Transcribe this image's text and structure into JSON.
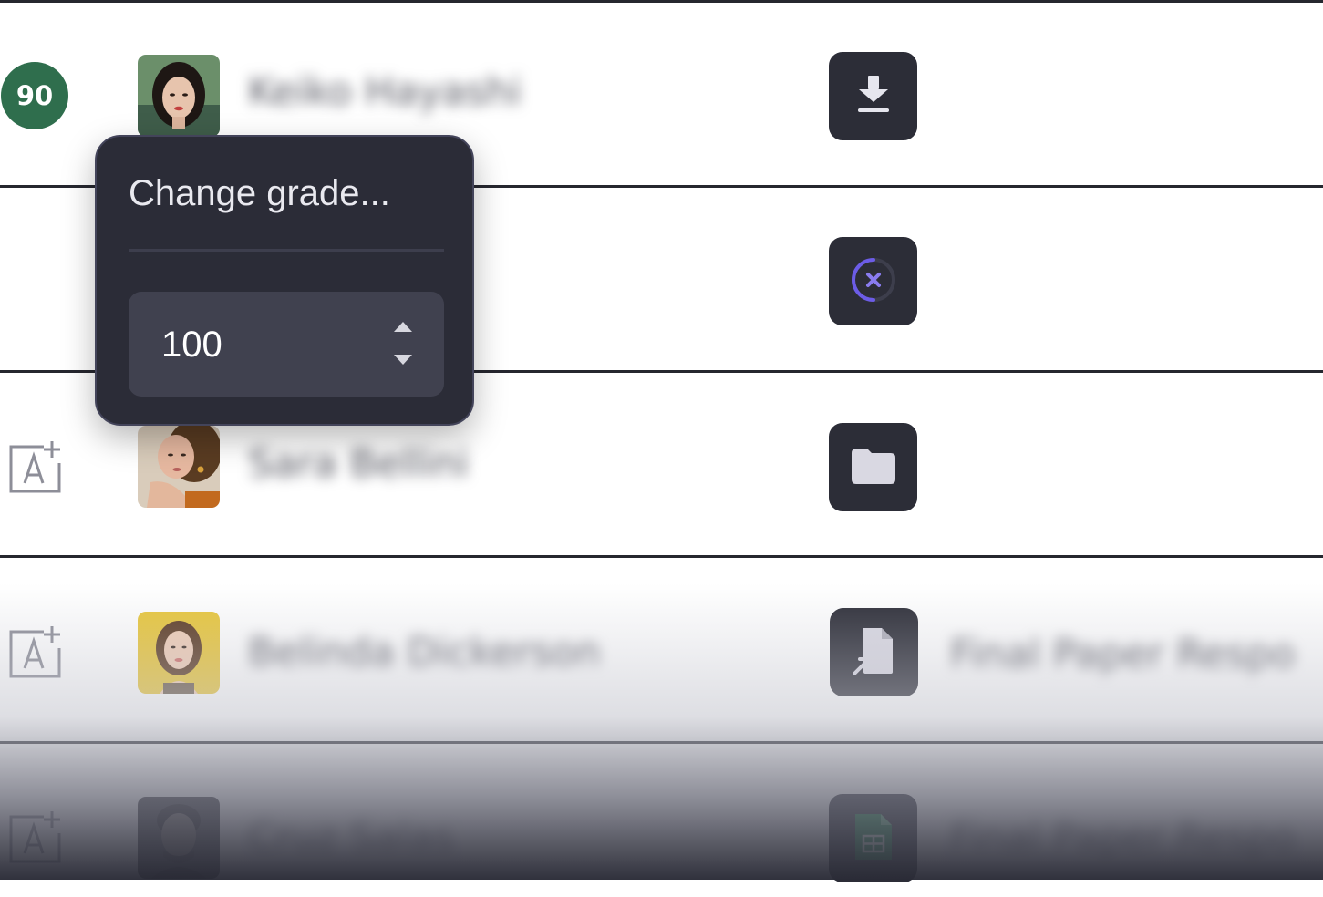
{
  "rows": [
    {
      "grade": "90",
      "student_name": "Keiko Hayashi",
      "file_icon": "download-icon",
      "file_name": ""
    },
    {
      "grade": "",
      "student_name": "",
      "file_icon": "missing-file-icon",
      "file_name": ""
    },
    {
      "grade": "",
      "student_name": "Sara Bellini",
      "file_icon": "folder-icon",
      "file_name": ""
    },
    {
      "grade": "",
      "student_name": "Belinda Dickerson",
      "file_icon": "file-shortcut-icon",
      "file_name": "Final Paper Respo"
    },
    {
      "grade": "",
      "student_name": "Cruz Salas",
      "file_icon": "spreadsheet-icon",
      "file_name": "Final Paper Respo"
    }
  ],
  "grade_popover": {
    "title": "Change grade...",
    "value": "100"
  },
  "colors": {
    "grade_badge": "#2f6e4d",
    "tile_bg": "#2c2d37",
    "popover_bg": "#2b2c37",
    "input_bg": "#40414f",
    "accent_purple": "#6c5ce7"
  }
}
